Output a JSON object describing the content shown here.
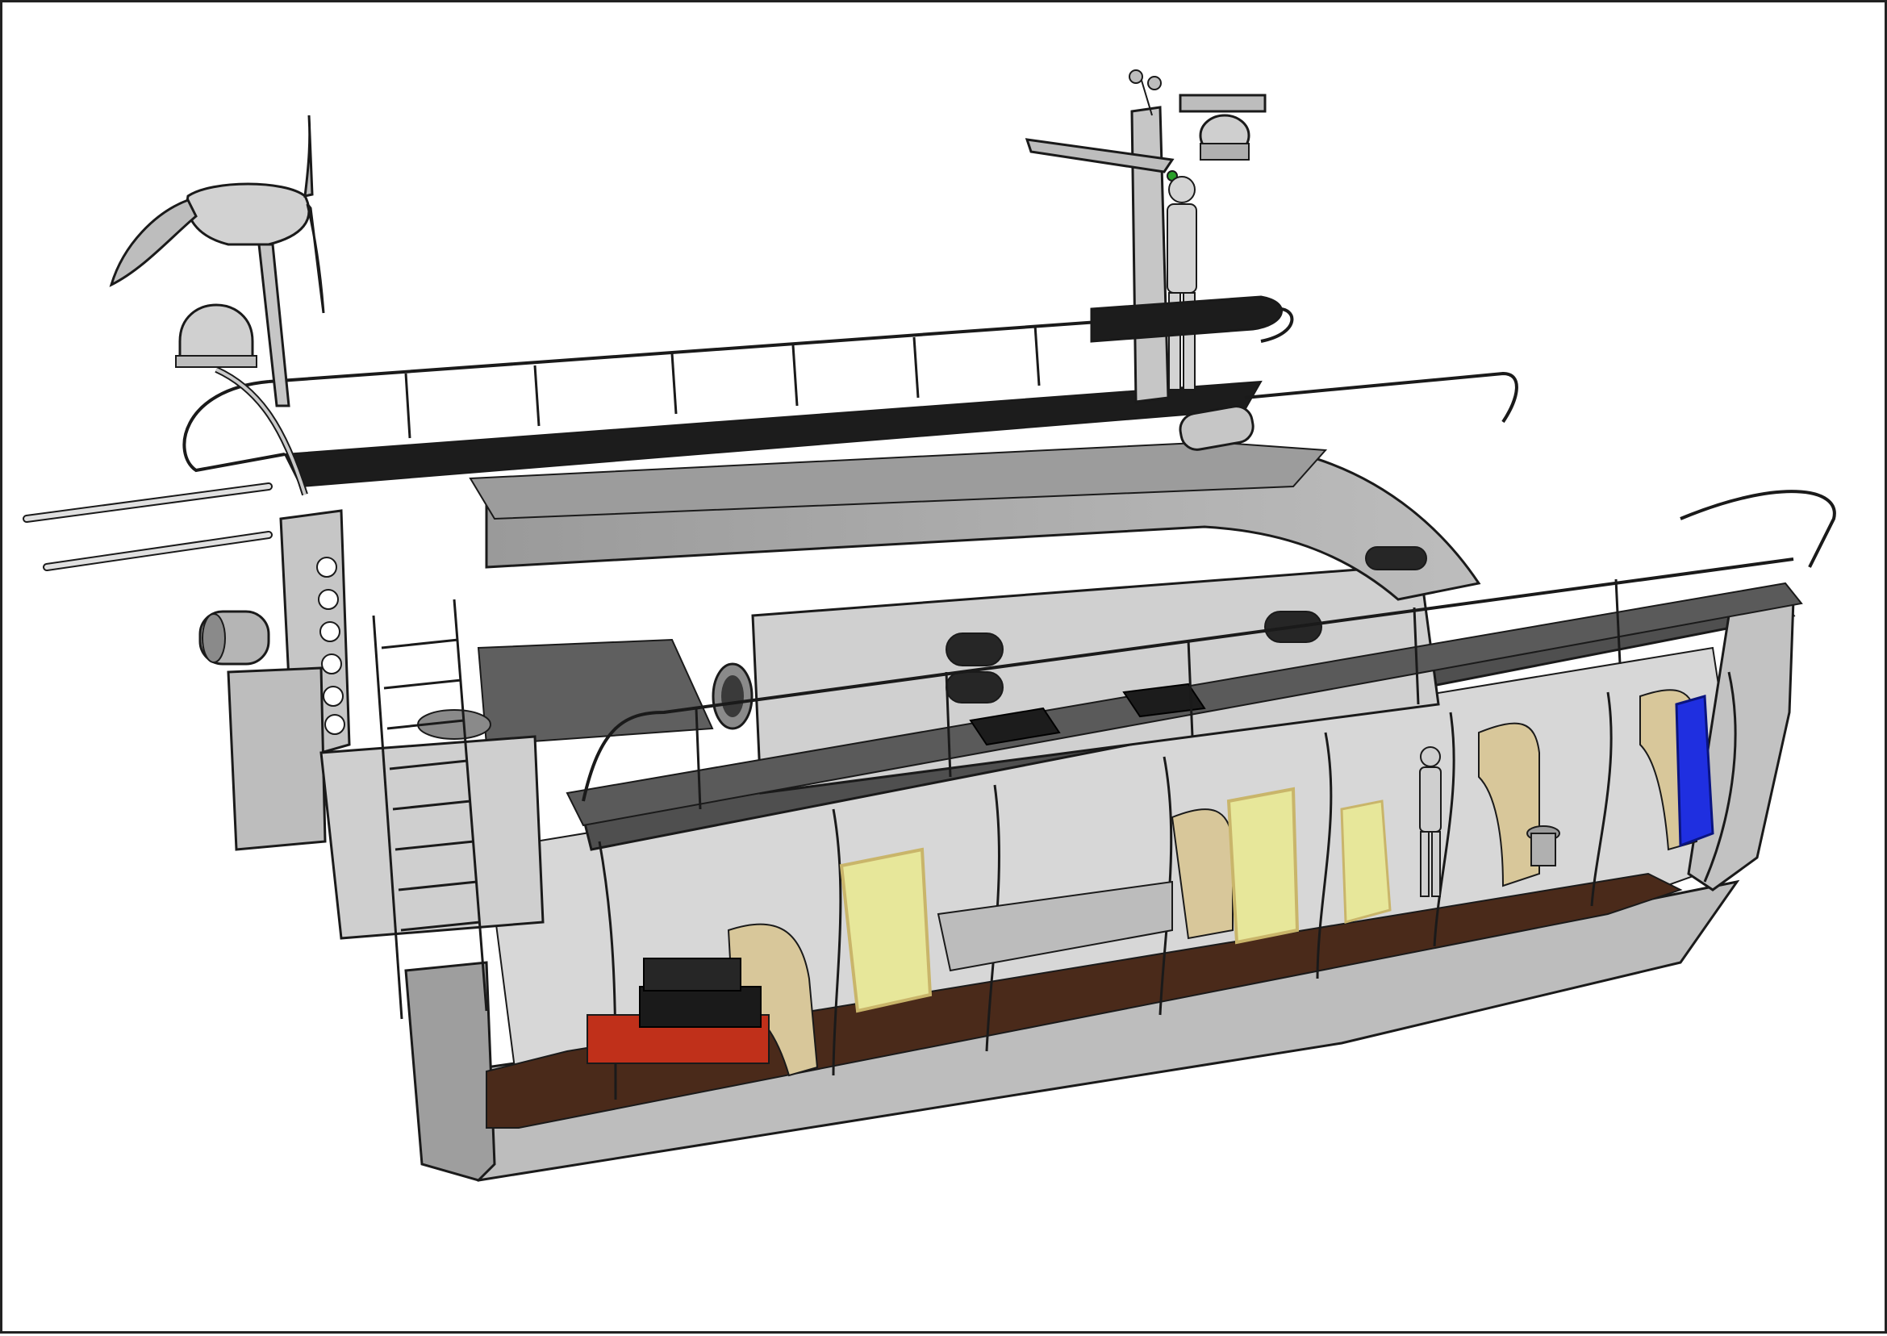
{
  "figure": {
    "subject": "boat-cutaway-illustration",
    "colors": {
      "hull": "#c9c9c9",
      "hull_light": "#dedede",
      "hull_dark": "#8f8f8f",
      "deck": "#5a5a5a",
      "roof_dark": "#1c1c1c",
      "outline": "#1a1a1a",
      "floor": "#4a2a1a",
      "cabinet": "#e7e79a",
      "cabinet_edge": "#c9b56a",
      "battery": "#1a1a1a",
      "pallet": "#c0301a",
      "water_tank": "#1f2fe0",
      "window": "#262626",
      "indicator_green": "#2aa02a"
    },
    "icons": {
      "wind_turbine": "wind-turbine-icon",
      "satellite_dome": "satellite-dome-icon",
      "radar": "radar-icon",
      "anemometer": "anemometer-icon",
      "human_figure": "human-figure-icon",
      "battery_bank": "battery-icon",
      "water_tank": "water-tank-icon",
      "toilet": "toilet-icon",
      "ladder": "ladder-icon",
      "porthole": "porthole-icon"
    }
  }
}
